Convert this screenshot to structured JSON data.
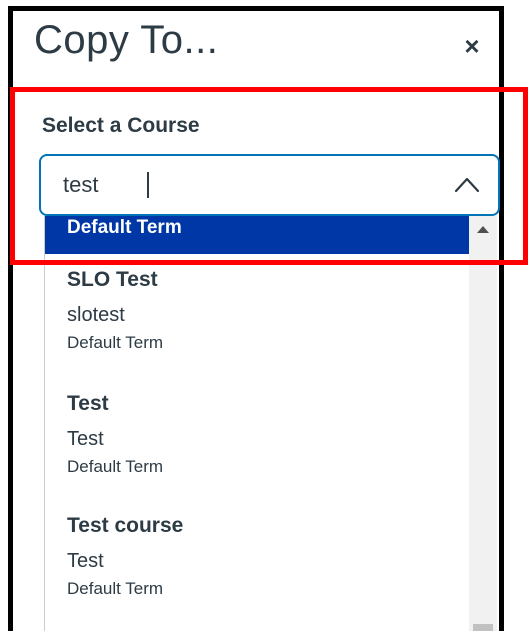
{
  "dialog": {
    "title": "Copy To...",
    "close_label": "×"
  },
  "course_select": {
    "label": "Select a Course",
    "value": "test",
    "highlighted_term": "Default Term",
    "options": [
      {
        "name": "SLO Test",
        "code": "slotest",
        "term": "Default Term"
      },
      {
        "name": "Test",
        "code": "Test",
        "term": "Default Term"
      },
      {
        "name": "Test course",
        "code": "Test",
        "term": "Default Term"
      }
    ]
  },
  "colors": {
    "focus_border": "#0374b5",
    "highlight": "#0037a6",
    "annotation": "#ff0000",
    "text": "#2d3b45"
  },
  "icons": {
    "close": "close-icon",
    "expand": "chevron-up-icon",
    "scroll_up": "scroll-up-arrow-icon"
  }
}
